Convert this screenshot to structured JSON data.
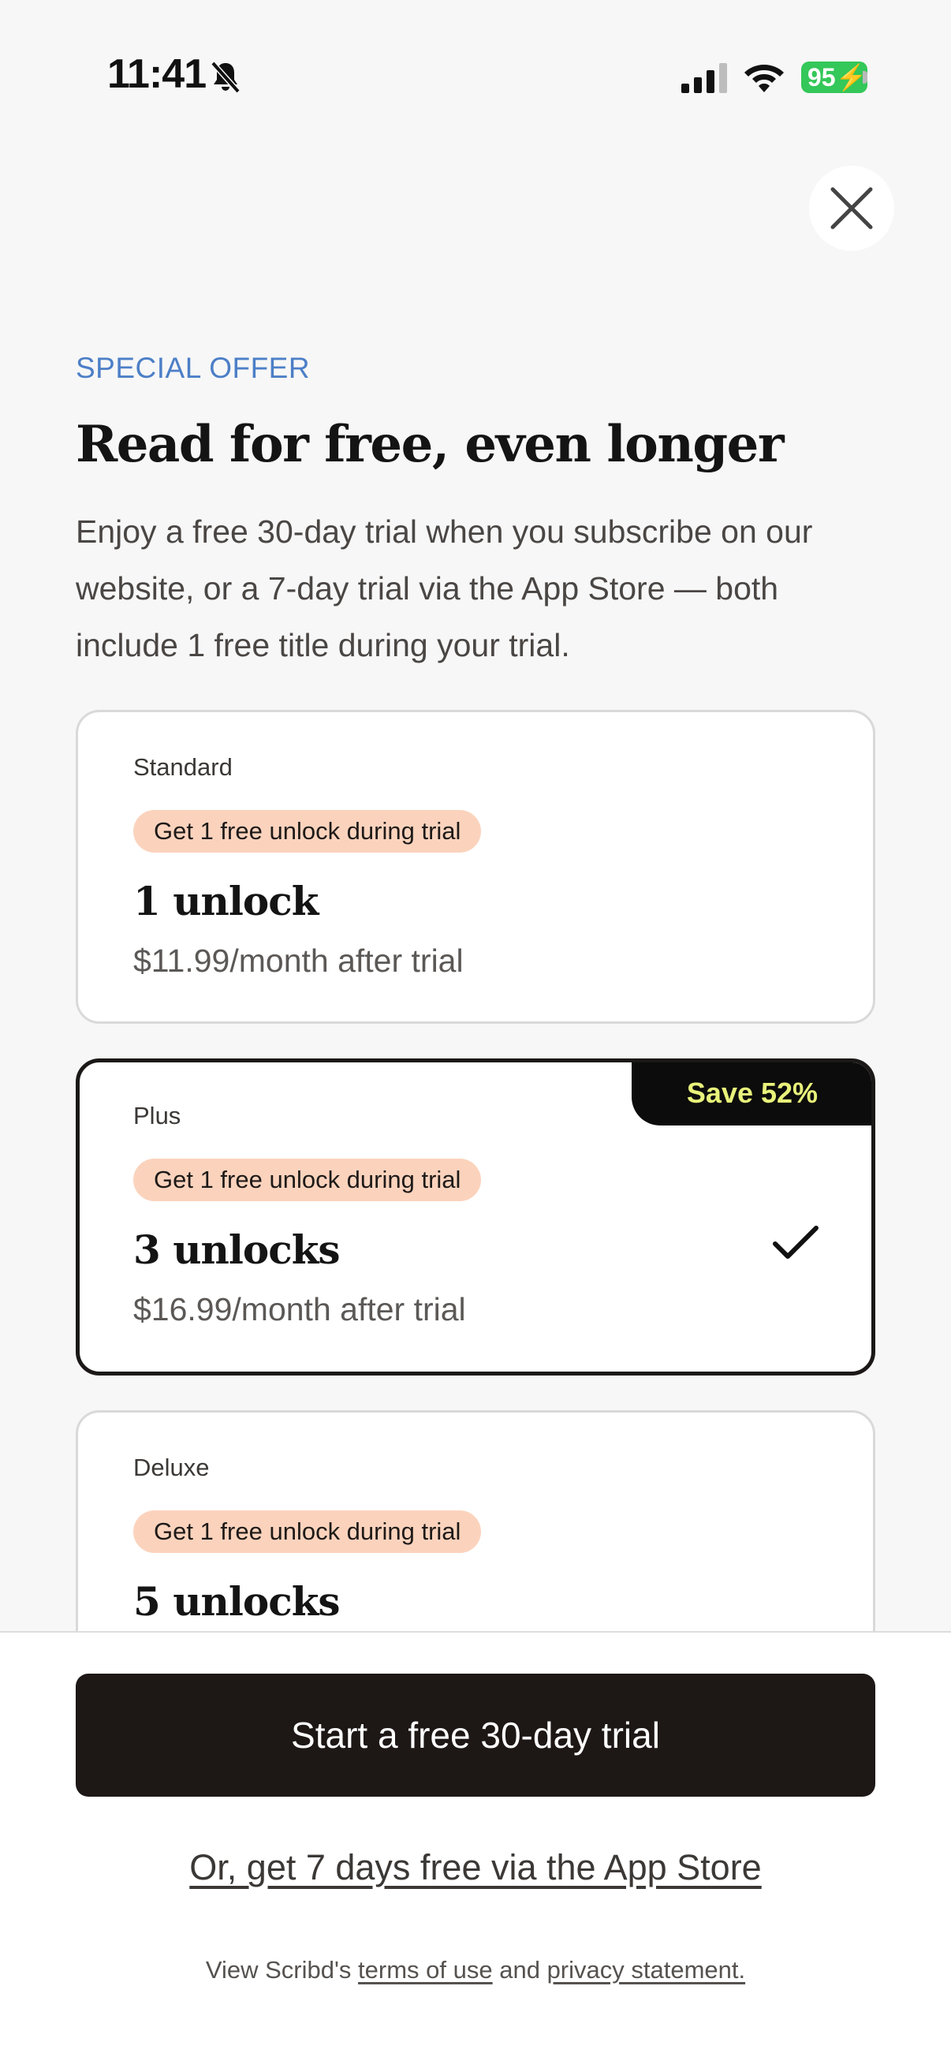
{
  "status_bar": {
    "time": "11:41",
    "battery": "95",
    "icons": [
      "bell-slash-icon",
      "signal-icon",
      "wifi-icon",
      "battery-charging-icon"
    ]
  },
  "close": {
    "icon": "close-icon"
  },
  "header": {
    "eyebrow": "SPECIAL OFFER",
    "title": "Read for free, even longer",
    "description": "Enjoy a free 30-day trial when you subscribe on our website, or a 7-day trial via the App Store — both include 1 free title during your trial."
  },
  "plans": [
    {
      "name": "Standard",
      "pill": "Get 1 free unlock during trial",
      "unlocks": "1 unlock",
      "price": "$11.99/month after trial",
      "selected": false
    },
    {
      "name": "Plus",
      "pill": "Get 1 free unlock during trial",
      "unlocks": "3 unlocks",
      "price": "$16.99/month after trial",
      "selected": true,
      "badge": "Save 52%"
    },
    {
      "name": "Deluxe",
      "pill": "Get 1 free unlock during trial",
      "unlocks": "5 unlocks",
      "selected": false
    }
  ],
  "footer": {
    "cta_label": "Start a free 30-day trial",
    "alt_link": "Or, get 7 days free via the App Store",
    "legal_prefix": "View Scribd's ",
    "terms_link": "terms of use",
    "legal_and": " and ",
    "privacy_link": "privacy statement."
  },
  "colors": {
    "accent_blue": "#4c7fc7",
    "pill_bg": "#fbd3bd",
    "cta_bg": "#1d1715",
    "badge_bg": "#0c0c0c",
    "badge_text": "#e8f27a",
    "battery": "#34c759"
  }
}
